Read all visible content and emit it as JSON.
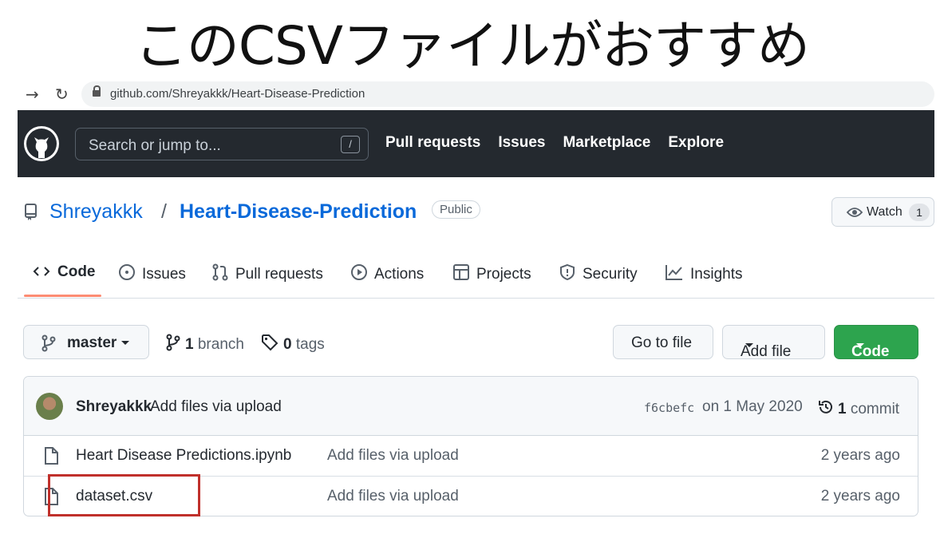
{
  "caption": "このCSVファイルがおすすめ",
  "browser": {
    "back_icon": "arrow-right-icon",
    "reload_icon": "reload-icon",
    "url": "github.com/Shreyakkk/Heart-Disease-Prediction"
  },
  "header": {
    "search_placeholder": "Search or jump to...",
    "search_shortcut": "/",
    "nav": [
      "Pull requests",
      "Issues",
      "Marketplace",
      "Explore"
    ]
  },
  "repo": {
    "owner": "Shreyakkk",
    "separator": "/",
    "name": "Heart-Disease-Prediction",
    "visibility": "Public",
    "watch_label": "Watch",
    "watch_count": "1"
  },
  "tabs": [
    {
      "label": "Code",
      "icon": "code-icon",
      "active": true
    },
    {
      "label": "Issues",
      "icon": "issue-icon"
    },
    {
      "label": "Pull requests",
      "icon": "pull-request-icon"
    },
    {
      "label": "Actions",
      "icon": "play-icon"
    },
    {
      "label": "Projects",
      "icon": "table-icon"
    },
    {
      "label": "Security",
      "icon": "shield-icon"
    },
    {
      "label": "Insights",
      "icon": "graph-icon"
    }
  ],
  "toolbar": {
    "branch": "master",
    "branch_count": "1",
    "branch_label": "branch",
    "tag_count": "0",
    "tag_label": "tags",
    "go_to_file": "Go to file",
    "add_file": "Add file",
    "code": "Code"
  },
  "commit": {
    "author": "Shreyakkk",
    "message": "Add files via upload",
    "hash": "f6cbefc",
    "date": "on 1 May 2020",
    "count": "1",
    "count_label": "commit"
  },
  "files": [
    {
      "name": "Heart Disease Predictions.ipynb",
      "message": "Add files via upload",
      "age": "2 years ago"
    },
    {
      "name": "dataset.csv",
      "message": "Add files via upload",
      "age": "2 years ago"
    }
  ],
  "colors": {
    "header_bg": "#24292f",
    "link": "#0969da",
    "code_button": "#2da44e",
    "highlight_box": "#c0302b",
    "tab_underline": "#fd8c73"
  }
}
